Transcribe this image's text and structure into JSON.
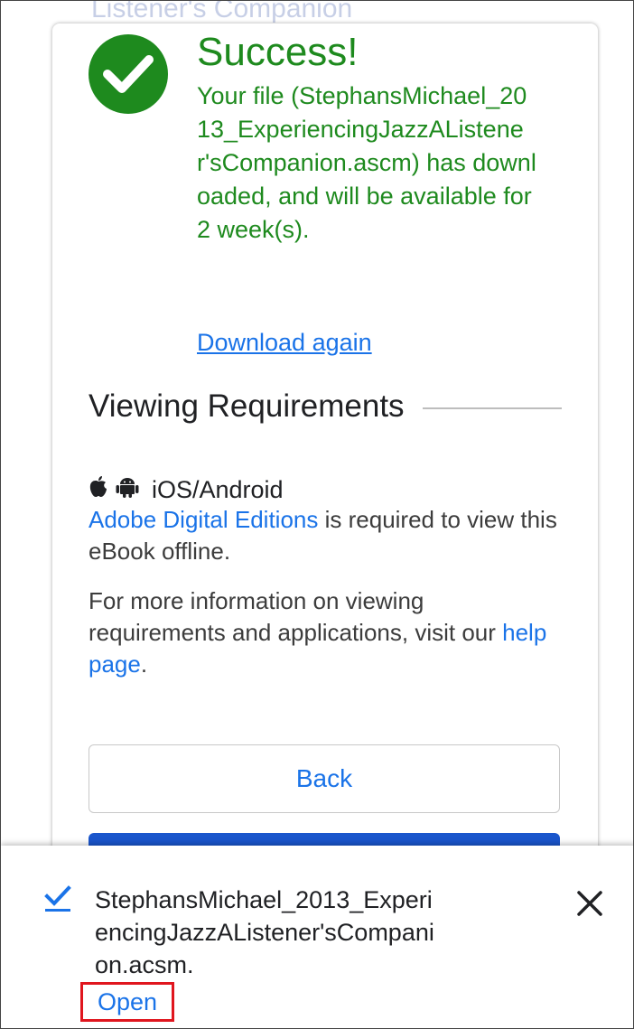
{
  "background_text": "Listener's Companion",
  "success": {
    "title": "Success!",
    "message": "Your file (StephansMichael_2013_ExperiencingJazzAListener'sCompanion.ascm) has downloaded, and will be available for 2 week(s).",
    "download_again_label": "Download again",
    "icon": "check-circle-icon",
    "color": "#1e8a1e"
  },
  "requirements": {
    "heading": "Viewing Requirements",
    "platform_icons": [
      "apple-icon",
      "android-icon"
    ],
    "platform_label": "iOS/Android",
    "ade_link": "Adobe Digital Editions",
    "ade_text": " is required to view this eBook offline.",
    "more_info_text": "For more information on viewing requirements and applications, visit our ",
    "help_link": "help page",
    "help_suffix": "."
  },
  "buttons": {
    "back_label": "Back",
    "primary_color": "#1a56cc"
  },
  "download_bar": {
    "status_icon": "check-icon",
    "filename": "StephansMichael_2013_ExperiencingJazzAListener'sCompanion.acsm.",
    "open_label": "Open",
    "close_icon": "close-icon"
  },
  "colors": {
    "link": "#1a73e8",
    "highlight_border": "#e0161e"
  }
}
